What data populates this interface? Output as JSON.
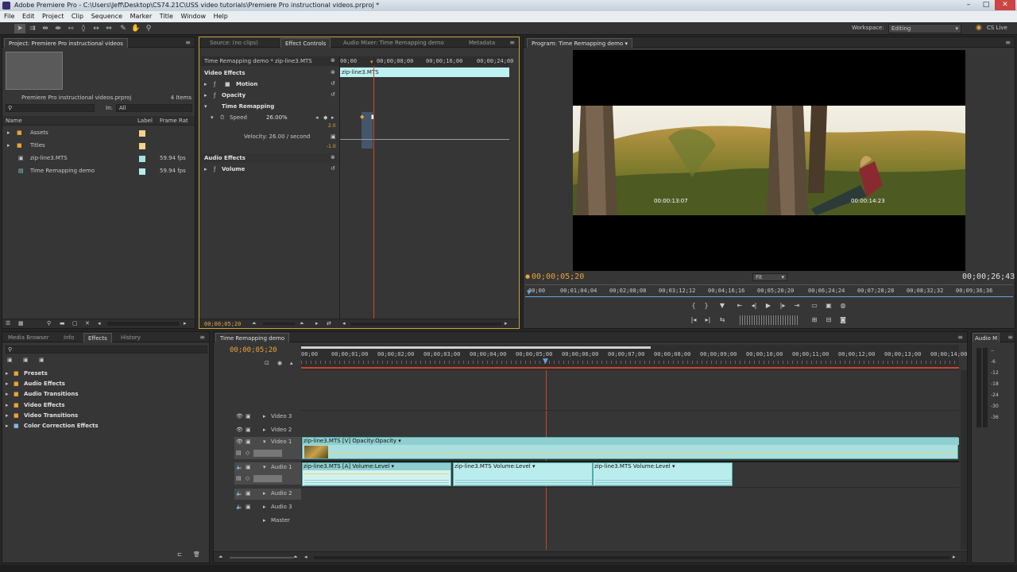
{
  "window": {
    "title": "Adobe Premiere Pro - C:\\Users\\Jeff\\Desktop\\CS74.21C\\USS video tutorials\\Premiere Pro instructional videos.prproj *"
  },
  "menu": [
    "File",
    "Edit",
    "Project",
    "Clip",
    "Sequence",
    "Marker",
    "Title",
    "Window",
    "Help"
  ],
  "workspace": {
    "label": "Workspace:",
    "value": "Editing",
    "cslive": "CS Live"
  },
  "project": {
    "tab": "Project: Premiere Pro instructional videos",
    "name": "Premiere Pro instructional videos.prproj",
    "count": "4 Items",
    "in_label": "In:",
    "in_value": "All",
    "columns": [
      "Name",
      "Label",
      "Frame Rat"
    ],
    "items": [
      {
        "name": "Assets",
        "fps": "",
        "color": "#f2d48a"
      },
      {
        "name": "Titles",
        "fps": "",
        "color": "#f2d48a"
      },
      {
        "name": "zip-line3.MTS",
        "fps": "59.94 fps",
        "color": "#a6e2e2"
      },
      {
        "name": "Time Remapping demo",
        "fps": "59.94 fps",
        "color": "#b8ecec"
      }
    ]
  },
  "effect_controls": {
    "tabs": [
      "Source: (no clips)",
      "Effect Controls",
      "Audio Mixer: Time Remapping demo",
      "Metadata"
    ],
    "header": "Time Remapping demo * zip-line3.MTS",
    "ruler": [
      "00;00",
      "00;00;08;00",
      "00;00;16;00",
      "00;00;24;00"
    ],
    "clip": "zip-line3.MTS",
    "video_effects": "Video Effects",
    "motion": "Motion",
    "opacity": "Opacity",
    "time_remapping": "Time Remapping",
    "speed_label": "Speed",
    "speed_value": "26.00%",
    "graph_top": "2.0",
    "graph_bottom": "-1.0",
    "velocity": "Velocity: 26.00 / second",
    "audio_effects": "Audio Effects",
    "volume": "Volume",
    "footer_tc": "00;00;05;20"
  },
  "program": {
    "tab": "Program: Time Remapping demo",
    "overlay_left": "00:00:13:07",
    "overlay_right": "00:00:14:23",
    "current_tc": "00;00;05;20",
    "fit": "Fit",
    "duration": "00;00;26;43",
    "ruler": [
      "00;00",
      "00;01;04;04",
      "00;02;08;08",
      "00;03;12;12",
      "00;04;16;16",
      "00;05;20;20",
      "00;06;24;24",
      "00;07;28;28",
      "00;08;32;32",
      "00;09;36;36"
    ]
  },
  "effects": {
    "tabs": [
      "Media Browser",
      "Info",
      "Effects",
      "History"
    ],
    "items": [
      "Presets",
      "Audio Effects",
      "Audio Transitions",
      "Video Effects",
      "Video Transitions",
      "Color Correction Effects"
    ]
  },
  "timeline": {
    "tab": "Time Remapping demo",
    "current_tc": "00;00;05;20",
    "ruler": [
      "00;00",
      "00;00;01;00",
      "00;00;02;00",
      "00;00;03;00",
      "00;00;04;00",
      "00;00;05;00",
      "00;00;06;00",
      "00;00;07;00",
      "00;00;08;00",
      "00;00;09;00",
      "00;00;10;00",
      "00;00;11;00",
      "00;00;12;00",
      "00;00;13;00",
      "00;00;14;00"
    ],
    "tracks": [
      "Video 3",
      "Video 2",
      "Video 1",
      "Audio 1",
      "Audio 2",
      "Audio 3",
      "Master"
    ],
    "video_clip": "zip-line3.MTS [V]  Opacity:Opacity ▾",
    "audio_clips": [
      "zip-line3.MTS [A]  Volume:Level ▾",
      "zip-line3.MTS   Volume:Level ▾",
      "zip-line3.MTS   Volume:Level ▾"
    ]
  },
  "audio_meter": {
    "tab": "Audio M",
    "labels": [
      "--",
      "-6",
      "-12",
      "-18",
      "-24",
      "-30",
      "-36"
    ]
  }
}
